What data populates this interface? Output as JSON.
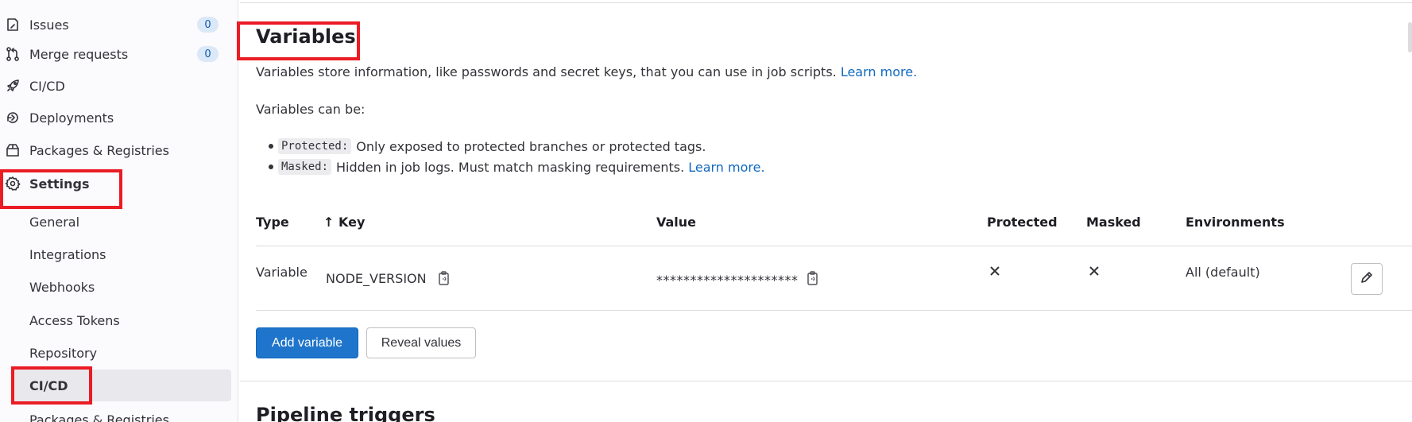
{
  "sidebar": {
    "items": [
      {
        "label": "Issues",
        "badge": "0",
        "icon": "issues-icon"
      },
      {
        "label": "Merge requests",
        "badge": "0",
        "icon": "merge-request-icon"
      },
      {
        "label": "CI/CD",
        "icon": "rocket-icon"
      },
      {
        "label": "Deployments",
        "icon": "deployments-icon"
      },
      {
        "label": "Packages & Registries",
        "icon": "package-icon"
      },
      {
        "label": "Settings",
        "icon": "gear-icon"
      }
    ],
    "sub_items": [
      {
        "label": "General"
      },
      {
        "label": "Integrations"
      },
      {
        "label": "Webhooks"
      },
      {
        "label": "Access Tokens"
      },
      {
        "label": "Repository"
      },
      {
        "label": "CI/CD"
      },
      {
        "label": "Packages & Registries"
      }
    ]
  },
  "variables": {
    "title": "Variables",
    "description": "Variables store information, like passwords and secret keys, that you can use in job scripts.",
    "learn_more": "Learn more.",
    "can_be": "Variables can be:",
    "bullets": [
      {
        "code": "Protected:",
        "text": "Only exposed to protected branches or protected tags."
      },
      {
        "code": "Masked:",
        "text": "Hidden in job logs. Must match masking requirements.",
        "link": "Learn more."
      }
    ],
    "table": {
      "headers": {
        "type": "Type",
        "sort_arrow": "↑",
        "key": "Key",
        "value": "Value",
        "protected": "Protected",
        "masked": "Masked",
        "environments": "Environments"
      },
      "rows": [
        {
          "type": "Variable",
          "key": "NODE_VERSION",
          "value": "*********************",
          "protected": "no",
          "masked": "no",
          "environments": "All (default)"
        }
      ]
    },
    "add_button": "Add variable",
    "reveal_button": "Reveal values"
  },
  "next_section": {
    "title": "Pipeline triggers"
  },
  "highlight_color": "#ea1c24",
  "accent_color": "#1f75cb"
}
